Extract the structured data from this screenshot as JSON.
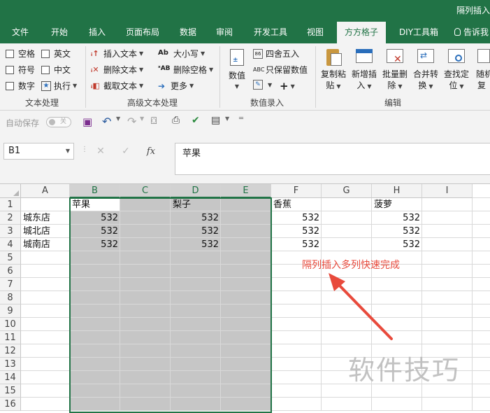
{
  "window": {
    "title": "隔列插入"
  },
  "tabs": [
    "文件",
    "开始",
    "插入",
    "页面布局",
    "数据",
    "审阅",
    "开发工具",
    "视图",
    "方方格子",
    "DIY工具箱",
    "告诉我"
  ],
  "ribbon": {
    "text_group": {
      "checkboxes": [
        "空格",
        "英文",
        "符号",
        "中文",
        "数字"
      ],
      "execute": "执行",
      "label": "文本处理"
    },
    "advanced_group": {
      "items": [
        "插入文本",
        "删除文本",
        "截取文本",
        "大小写",
        "删除空格",
        "更多"
      ],
      "label": "高级文本处理"
    },
    "value_group": {
      "value_button": "数值",
      "round": "四舍五入",
      "keep_values": "只保留数值",
      "label": "数值录入"
    },
    "edit_group": {
      "buttons": [
        "复制粘贴",
        "新增插入",
        "批量删除",
        "合并转换",
        "查找定位",
        "随机重复"
      ],
      "label": "编辑"
    }
  },
  "qat": {
    "autosave": "自动保存",
    "autosave_state": "关"
  },
  "formula_bar": {
    "cell_ref": "B1",
    "formula": "苹果",
    "fx": "fx"
  },
  "grid": {
    "columns": [
      "A",
      "B",
      "C",
      "D",
      "E",
      "F",
      "G",
      "H",
      "I"
    ],
    "rows": [
      "1",
      "2",
      "3",
      "4",
      "5",
      "6",
      "7",
      "8",
      "9",
      "10",
      "11",
      "12",
      "13",
      "14",
      "15",
      "16"
    ],
    "headers": {
      "B1": "苹果",
      "D1": "梨子",
      "F1": "香蕉",
      "H1": "菠萝"
    },
    "stores": [
      "城东店",
      "城北店",
      "城南店"
    ],
    "value": "532"
  },
  "annotation": "隔列插入多列快速完成",
  "watermark": "软件技巧",
  "colors": {
    "excel_green": "#217346",
    "annotation_red": "#e84a3c"
  }
}
